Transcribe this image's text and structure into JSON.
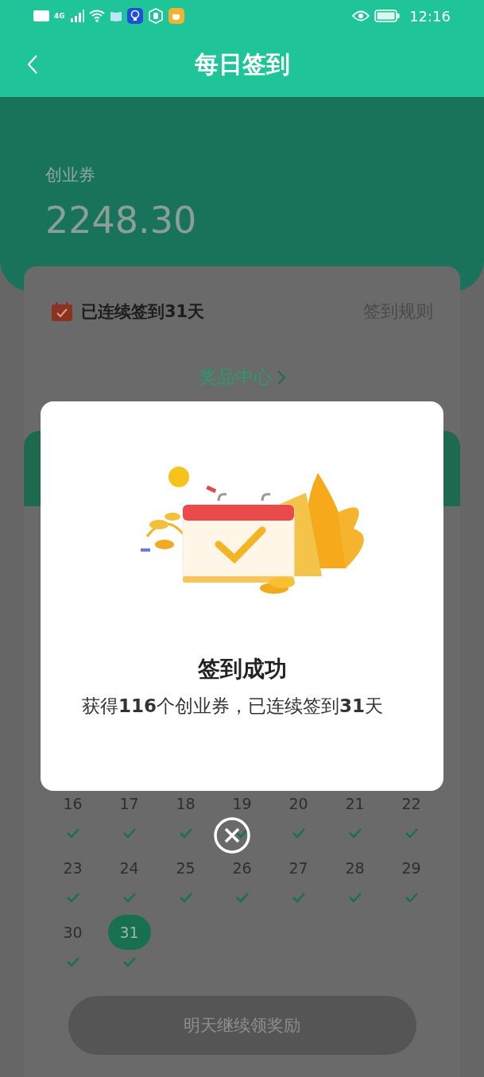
{
  "status_bar": {
    "time": "12:16",
    "network": "4G"
  },
  "nav": {
    "title": "每日签到"
  },
  "header": {
    "label": "创业券",
    "amount": "2248.30"
  },
  "streak": {
    "text": "已连续签到**31**天",
    "rules_link": "签到规则"
  },
  "prize_link": "奖品中心",
  "calendar": {
    "days": [
      {
        "day": "16",
        "checked": true,
        "selected": false
      },
      {
        "day": "17",
        "checked": true,
        "selected": false
      },
      {
        "day": "18",
        "checked": true,
        "selected": false
      },
      {
        "day": "19",
        "checked": true,
        "selected": false
      },
      {
        "day": "20",
        "checked": true,
        "selected": false
      },
      {
        "day": "21",
        "checked": true,
        "selected": false
      },
      {
        "day": "22",
        "checked": true,
        "selected": false
      },
      {
        "day": "23",
        "checked": true,
        "selected": false
      },
      {
        "day": "24",
        "checked": true,
        "selected": false
      },
      {
        "day": "25",
        "checked": true,
        "selected": false
      },
      {
        "day": "26",
        "checked": true,
        "selected": false
      },
      {
        "day": "27",
        "checked": true,
        "selected": false
      },
      {
        "day": "28",
        "checked": true,
        "selected": false
      },
      {
        "day": "29",
        "checked": true,
        "selected": false
      },
      {
        "day": "30",
        "checked": true,
        "selected": false
      },
      {
        "day": "31",
        "checked": true,
        "selected": true
      }
    ]
  },
  "bottom_button": {
    "label": "明天继续领奖励",
    "disabled": true
  },
  "dialog": {
    "title": "签到成功",
    "message": "获得**116**个创业券，已连续签到**31**天"
  }
}
